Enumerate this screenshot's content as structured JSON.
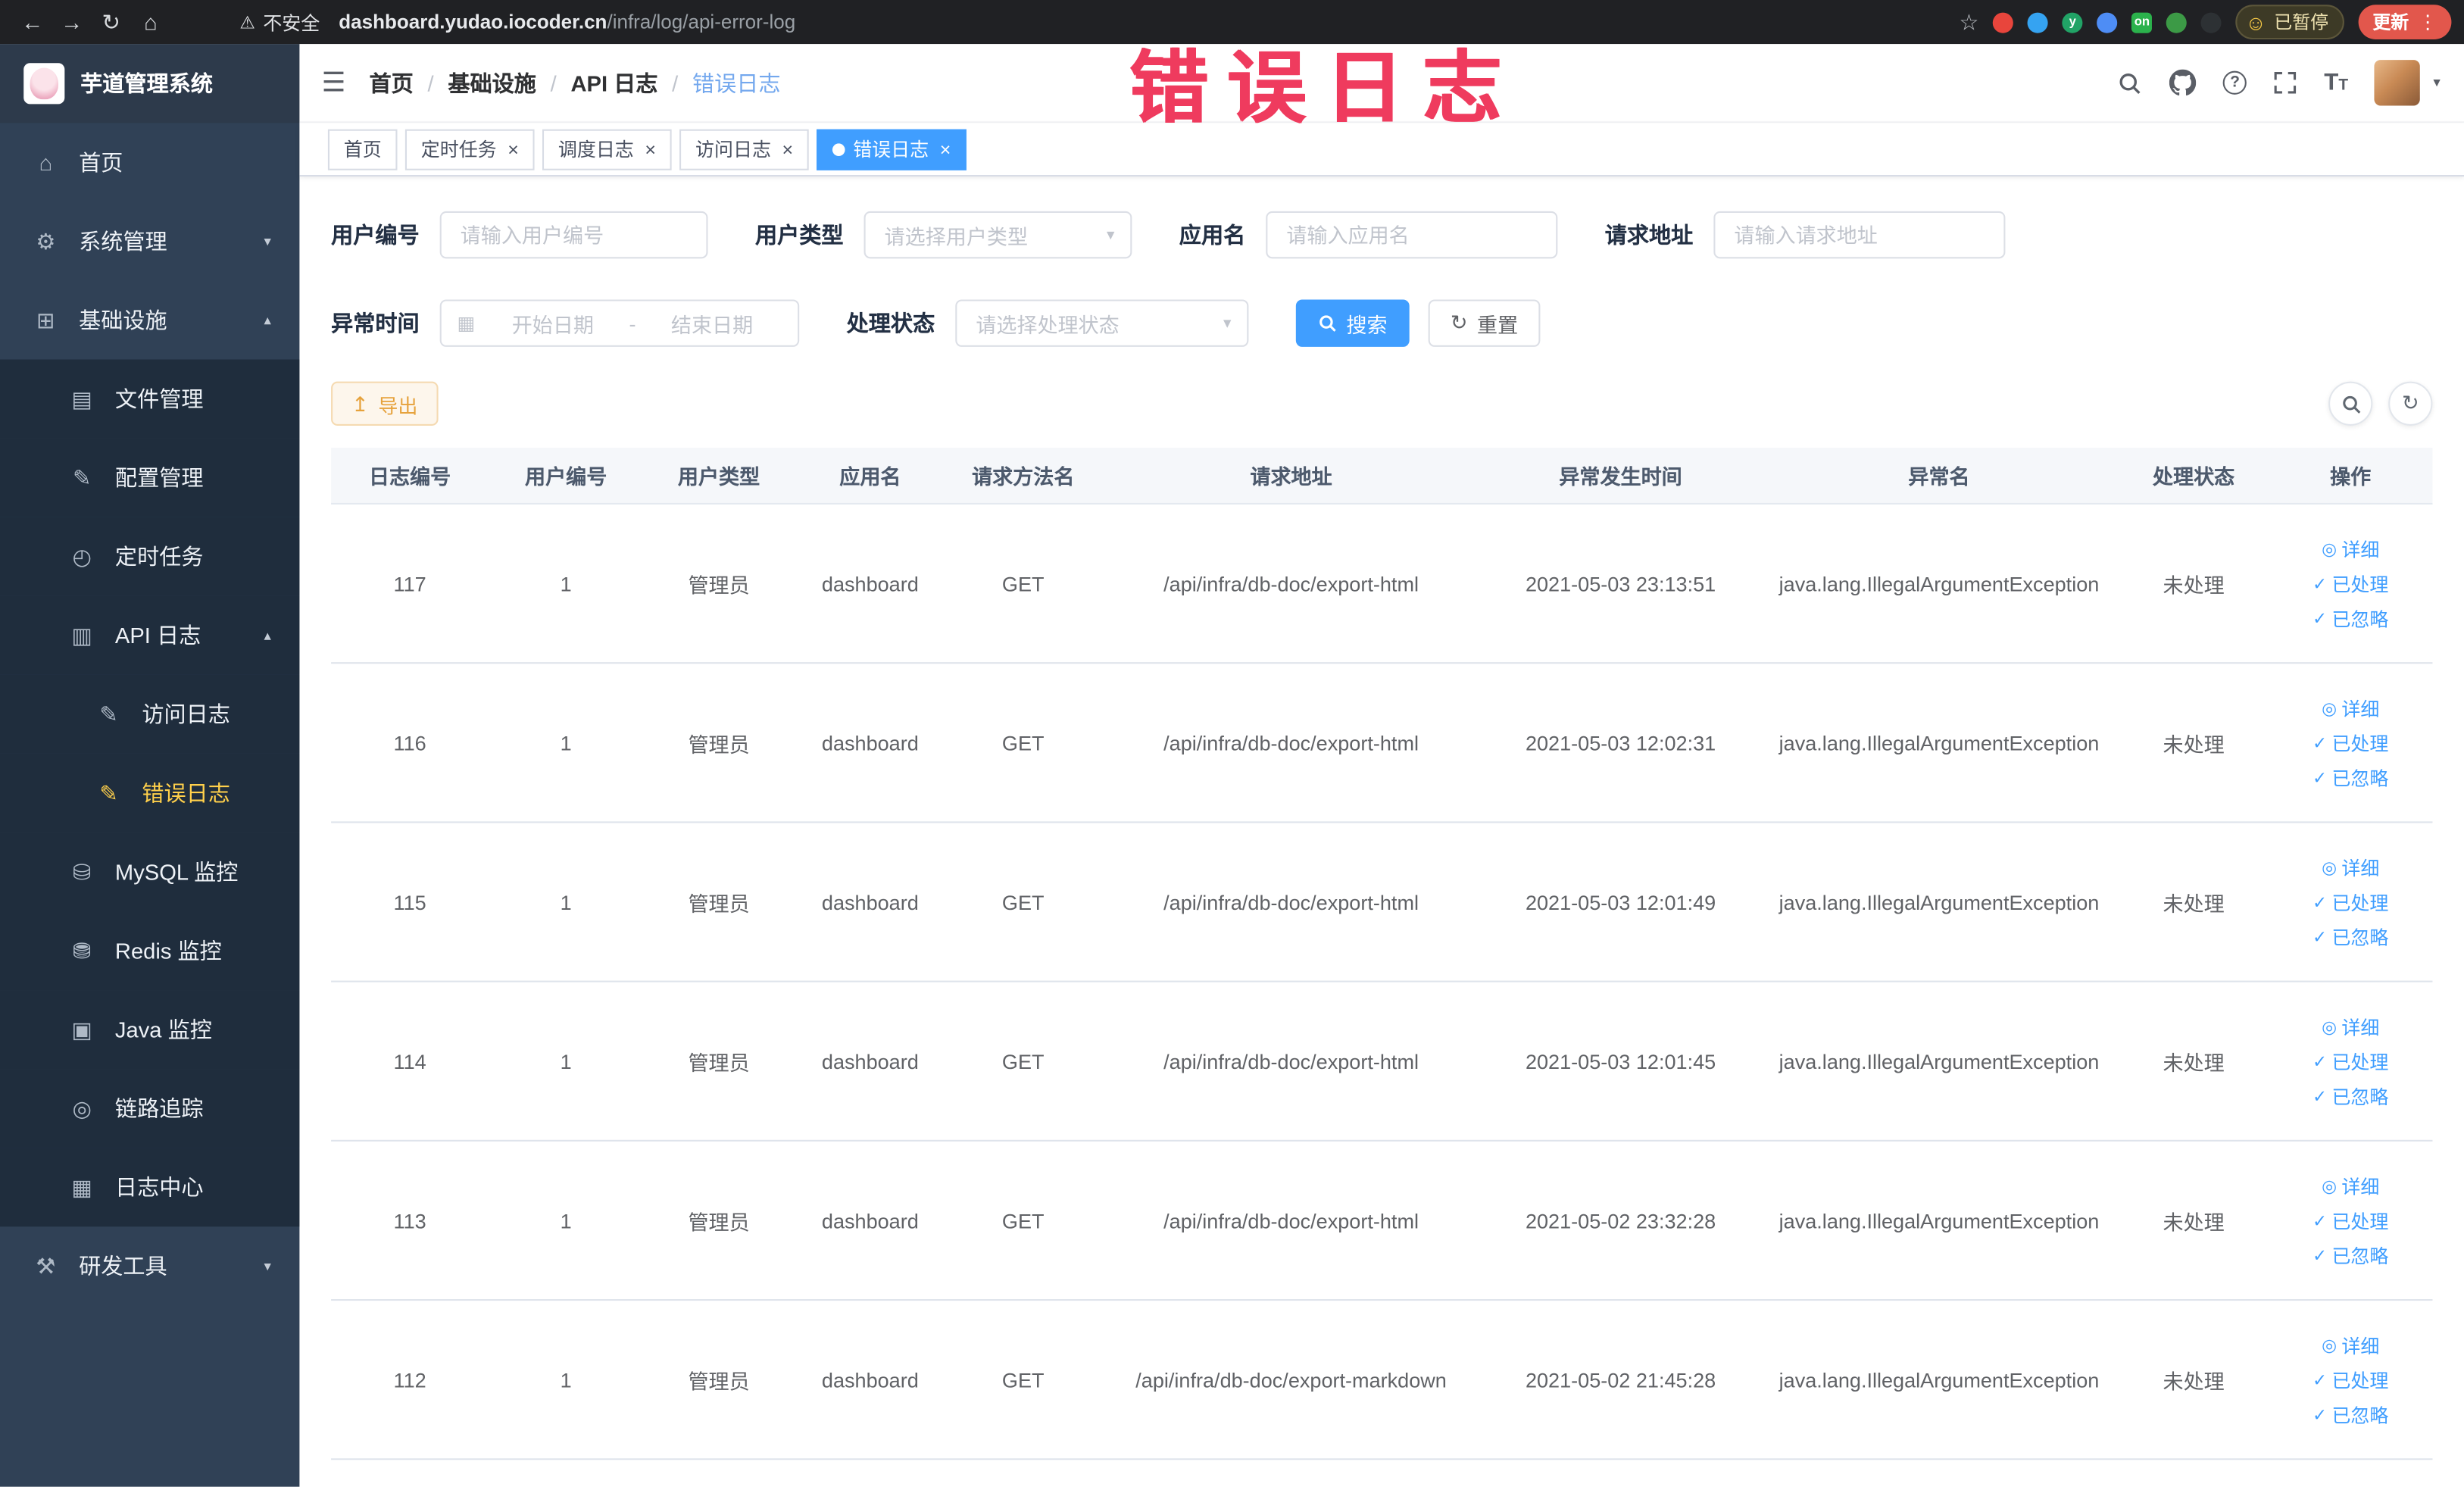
{
  "annotation": {
    "text": "错误日志",
    "color": "#ef3b5e"
  },
  "browser": {
    "security_label": "不安全",
    "url_domain": "dashboard.yudao.iocoder.cn",
    "url_path": "/infra/log/api-error-log",
    "paused_badge": "已暂停",
    "update_button": "更新",
    "extensions": [
      {
        "color": "#e8453c",
        "text": ""
      },
      {
        "color": "#35a3f1",
        "text": ""
      },
      {
        "color": "#21a366",
        "text": "y"
      },
      {
        "color": "#4e8df5",
        "text": ""
      },
      {
        "color": "#2bb24c",
        "text": "on"
      },
      {
        "color": "#3c9a46",
        "text": ""
      },
      {
        "color": "#2d3134",
        "text": ""
      }
    ]
  },
  "sidebar": {
    "logo_title": "芋道管理系统",
    "items": [
      {
        "label": "首页",
        "icon": "home-icon",
        "glyph": "⌂",
        "level": 0
      },
      {
        "label": "系统管理",
        "icon": "gear-icon",
        "glyph": "⚙",
        "level": 0,
        "arrow": "down"
      },
      {
        "label": "基础设施",
        "icon": "infrastructure-icon",
        "glyph": "⊞",
        "level": 0,
        "arrow": "up"
      },
      {
        "label": "文件管理",
        "icon": "file-manage-icon",
        "glyph": "▤",
        "level": 1
      },
      {
        "label": "配置管理",
        "icon": "config-manage-icon",
        "glyph": "✎",
        "level": 1
      },
      {
        "label": "定时任务",
        "icon": "timer-icon",
        "glyph": "◴",
        "level": 1
      },
      {
        "label": "API 日志",
        "icon": "api-log-icon",
        "glyph": "▥",
        "level": 1,
        "arrow": "up"
      },
      {
        "label": "访问日志",
        "icon": "access-log-icon",
        "glyph": "✎",
        "level": 2
      },
      {
        "label": "错误日志",
        "icon": "error-log-icon",
        "glyph": "✎",
        "level": 2,
        "active": true
      },
      {
        "label": "MySQL 监控",
        "icon": "mysql-monitor-icon",
        "glyph": "⛁",
        "level": 1
      },
      {
        "label": "Redis 监控",
        "icon": "redis-monitor-icon",
        "glyph": "⛃",
        "level": 1
      },
      {
        "label": "Java 监控",
        "icon": "java-monitor-icon",
        "glyph": "▣",
        "level": 1
      },
      {
        "label": "链路追踪",
        "icon": "trace-icon",
        "glyph": "◎",
        "level": 1
      },
      {
        "label": "日志中心",
        "icon": "log-center-icon",
        "glyph": "▦",
        "level": 1
      },
      {
        "label": "研发工具",
        "icon": "dev-tools-icon",
        "glyph": "⚒",
        "level": 0,
        "arrow": "down"
      }
    ]
  },
  "breadcrumb": [
    "首页",
    "基础设施",
    "API 日志",
    "错误日志"
  ],
  "tabs": [
    {
      "label": "首页",
      "closable": false,
      "active": false
    },
    {
      "label": "定时任务",
      "closable": true,
      "active": false
    },
    {
      "label": "调度日志",
      "closable": true,
      "active": false
    },
    {
      "label": "访问日志",
      "closable": true,
      "active": false
    },
    {
      "label": "错误日志",
      "closable": true,
      "active": true
    }
  ],
  "filters": {
    "user_id": {
      "label": "用户编号",
      "placeholder": "请输入用户编号"
    },
    "user_type": {
      "label": "用户类型",
      "placeholder": "请选择用户类型"
    },
    "app_name": {
      "label": "应用名",
      "placeholder": "请输入应用名"
    },
    "request_url": {
      "label": "请求地址",
      "placeholder": "请输入请求地址"
    },
    "exception_time": {
      "label": "异常时间",
      "start_placeholder": "开始日期",
      "separator": "-",
      "end_placeholder": "结束日期"
    },
    "process_status": {
      "label": "处理状态",
      "placeholder": "请选择处理状态"
    },
    "search_button": "搜索",
    "reset_button": "重置"
  },
  "toolbar": {
    "export_label": "导出"
  },
  "table": {
    "columns": [
      "日志编号",
      "用户编号",
      "用户类型",
      "应用名",
      "请求方法名",
      "请求地址",
      "异常发生时间",
      "异常名",
      "处理状态",
      "操作"
    ],
    "rows": [
      {
        "id": "117",
        "user_id": "1",
        "user_type": "管理员",
        "app": "dashboard",
        "method": "GET",
        "url": "/api/infra/db-doc/export-html",
        "time": "2021-05-03 23:13:51",
        "exception": "java.lang.IllegalArgumentException",
        "status": "未处理"
      },
      {
        "id": "116",
        "user_id": "1",
        "user_type": "管理员",
        "app": "dashboard",
        "method": "GET",
        "url": "/api/infra/db-doc/export-html",
        "time": "2021-05-03 12:02:31",
        "exception": "java.lang.IllegalArgumentException",
        "status": "未处理"
      },
      {
        "id": "115",
        "user_id": "1",
        "user_type": "管理员",
        "app": "dashboard",
        "method": "GET",
        "url": "/api/infra/db-doc/export-html",
        "time": "2021-05-03 12:01:49",
        "exception": "java.lang.IllegalArgumentException",
        "status": "未处理"
      },
      {
        "id": "114",
        "user_id": "1",
        "user_type": "管理员",
        "app": "dashboard",
        "method": "GET",
        "url": "/api/infra/db-doc/export-html",
        "time": "2021-05-03 12:01:45",
        "exception": "java.lang.IllegalArgumentException",
        "status": "未处理"
      },
      {
        "id": "113",
        "user_id": "1",
        "user_type": "管理员",
        "app": "dashboard",
        "method": "GET",
        "url": "/api/infra/db-doc/export-html",
        "time": "2021-05-02 23:32:28",
        "exception": "java.lang.IllegalArgumentException",
        "status": "未处理"
      },
      {
        "id": "112",
        "user_id": "1",
        "user_type": "管理员",
        "app": "dashboard",
        "method": "GET",
        "url": "/api/infra/db-doc/export-markdown",
        "time": "2021-05-02 21:45:28",
        "exception": "java.lang.IllegalArgumentException",
        "status": "未处理"
      }
    ],
    "row_actions": [
      {
        "label": "详细",
        "name": "detail",
        "icon": "eye-icon",
        "glyph": "◎"
      },
      {
        "label": "已处理",
        "name": "mark-processed",
        "icon": "check-icon",
        "glyph": "✓"
      },
      {
        "label": "已忽略",
        "name": "mark-ignored",
        "icon": "check-icon",
        "glyph": "✓"
      }
    ]
  }
}
